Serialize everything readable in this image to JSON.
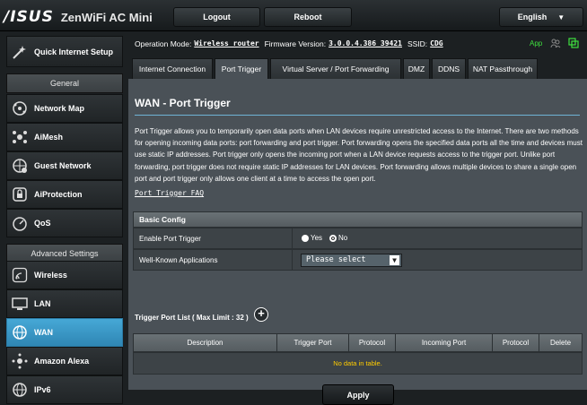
{
  "header": {
    "logo": "/ISUS",
    "product": "ZenWiFi AC Mini",
    "logout": "Logout",
    "reboot": "Reboot",
    "language": "English"
  },
  "sidebar": {
    "quick_setup": "Quick Internet Setup",
    "general_header": "General",
    "general": [
      {
        "label": "Network Map",
        "icon": "network-map-icon"
      },
      {
        "label": "AiMesh",
        "icon": "aimesh-icon"
      },
      {
        "label": "Guest Network",
        "icon": "guest-network-icon"
      },
      {
        "label": "AiProtection",
        "icon": "shield-icon"
      },
      {
        "label": "QoS",
        "icon": "gauge-icon"
      }
    ],
    "advanced_header": "Advanced Settings",
    "advanced": [
      {
        "label": "Wireless",
        "icon": "wifi-icon"
      },
      {
        "label": "LAN",
        "icon": "monitor-icon"
      },
      {
        "label": "WAN",
        "icon": "globe-icon",
        "active": true
      },
      {
        "label": "Amazon Alexa",
        "icon": "alexa-icon"
      },
      {
        "label": "IPv6",
        "icon": "globe-icon"
      }
    ]
  },
  "status": {
    "op_mode_label": "Operation Mode:",
    "op_mode": "Wireless router",
    "fw_label": "Firmware Version:",
    "fw": "3.0.0.4.386_39421",
    "ssid_label": "SSID:",
    "ssid": "CDG",
    "app": "App"
  },
  "tabs": [
    "Internet Connection",
    "Port Trigger",
    "Virtual Server / Port Forwarding",
    "DMZ",
    "DDNS",
    "NAT Passthrough"
  ],
  "page": {
    "title": "WAN - Port Trigger",
    "description": "Port Trigger allows you to temporarily open data ports when LAN devices require unrestricted access to the Internet. There are two methods for opening incoming data ports: port forwarding and port trigger. Port forwarding opens the specified data ports all the time and devices must use static IP addresses. Port trigger only opens the incoming port when a LAN device requests access to the trigger port. Unlike port forwarding, port trigger does not require static IP addresses for LAN devices. Port forwarding allows multiple devices to share a single open port and port trigger only allows one client at a time to access the open port.",
    "faq": "Port Trigger FAQ"
  },
  "basic_config": {
    "header": "Basic Config",
    "enable_label": "Enable Port Trigger",
    "yes": "Yes",
    "no": "No",
    "selected": "No",
    "apps_label": "Well-Known Applications",
    "apps_value": "Please select"
  },
  "trigger_list": {
    "label": "Trigger Port List ( Max Limit : 32 )",
    "columns": [
      "Description",
      "Trigger Port",
      "Protocol",
      "Incoming Port",
      "Protocol",
      "Delete"
    ],
    "empty": "No data in table."
  },
  "apply": "Apply"
}
